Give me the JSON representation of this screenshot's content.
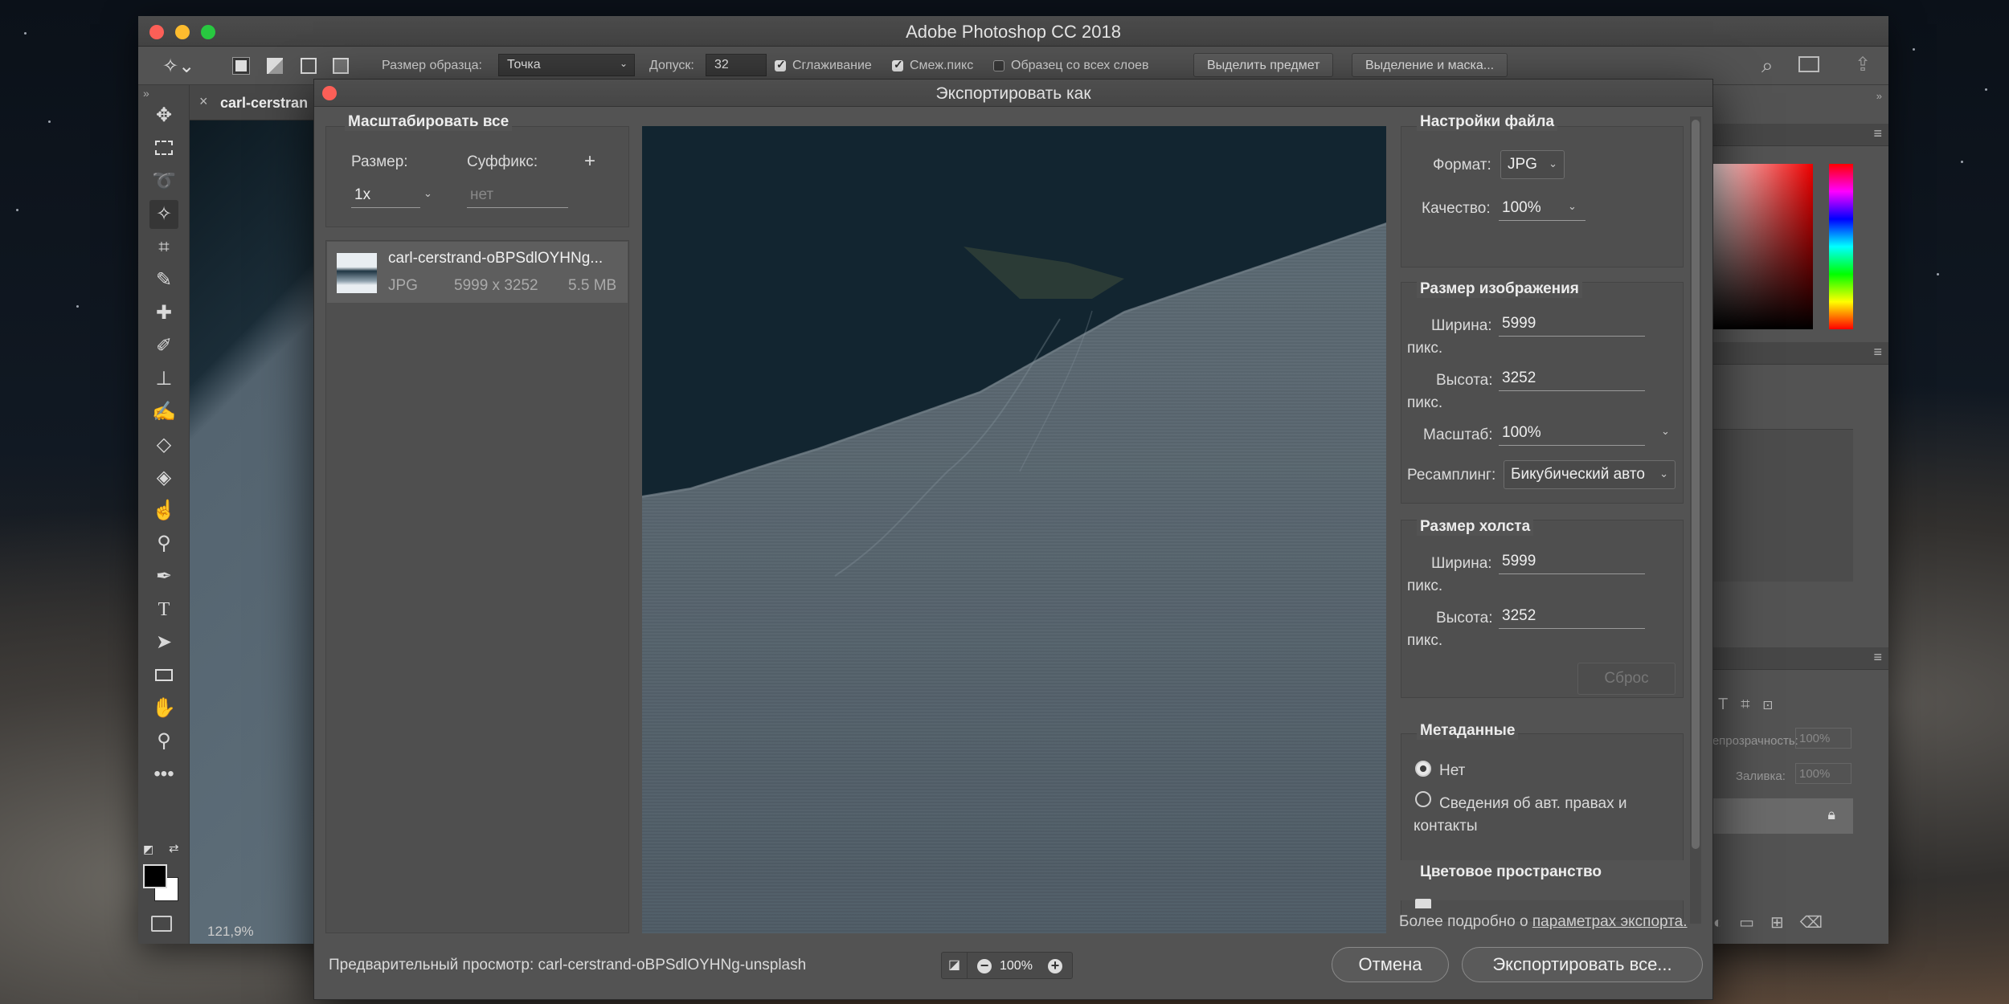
{
  "photoshop": {
    "app_title": "Adobe Photoshop CC 2018",
    "options_bar": {
      "sample_size_label": "Размер образца:",
      "sample_size_value": "Точка",
      "tolerance_label": "Допуск:",
      "tolerance_value": "32",
      "antialias_label": "Сглаживание",
      "contiguous_label": "Смеж.пикс",
      "sample_all_layers_label": "Образец со всех слоев",
      "select_subject_button": "Выделить предмет",
      "select_and_mask_button": "Выделение и маска..."
    },
    "document_tab": "carl-cerstran",
    "zoom_status": "121,9%",
    "right_panel": {
      "opacity_label": "Непрозрачность:",
      "opacity_value": "100%",
      "fill_label": "Заливка:",
      "fill_value": "100%"
    }
  },
  "dialog": {
    "title": "Экспортировать как",
    "scale_all": {
      "header": "Масштабировать все",
      "size_label": "Размер:",
      "suffix_label": "Суффикс:",
      "add_button": "+",
      "size_value": "1x",
      "suffix_placeholder": "нет"
    },
    "file_item": {
      "name": "carl-cerstrand-oBPSdlOYHNg...",
      "format": "JPG",
      "dimensions": "5999 x 3252",
      "size": "5.5 MB"
    },
    "file_settings": {
      "header": "Настройки файла",
      "format_label": "Формат:",
      "format_value": "JPG",
      "quality_label": "Качество:",
      "quality_value": "100%"
    },
    "image_size": {
      "header": "Размер изображения",
      "width_label": "Ширина:",
      "width_value": "5999",
      "width_unit": "пикс.",
      "height_label": "Высота:",
      "height_value": "3252",
      "height_unit": "пикс.",
      "scale_label": "Масштаб:",
      "scale_value": "100%",
      "resample_label": "Ресамплинг:",
      "resample_value": "Бикубический авто"
    },
    "canvas_size": {
      "header": "Размер холста",
      "width_label": "Ширина:",
      "width_value": "5999",
      "width_unit": "пикс.",
      "height_label": "Высота:",
      "height_value": "3252",
      "height_unit": "пикс.",
      "reset_button": "Сброс"
    },
    "metadata": {
      "header": "Метаданные",
      "option_none": "Нет",
      "option_copyright": "Сведения об авт. правах и контакты",
      "selected": "Нет"
    },
    "color_space": {
      "header": "Цветовое пространство"
    },
    "learn_more_prefix": "Более подробно о ",
    "learn_more_link": "параметрах экспорта.",
    "preview_label": "Предварительный просмотр: carl-cerstrand-oBPSdlOYHNg-unsplash",
    "zoom_value": "100%",
    "cancel_button": "Отмена",
    "export_button": "Экспортировать все..."
  }
}
